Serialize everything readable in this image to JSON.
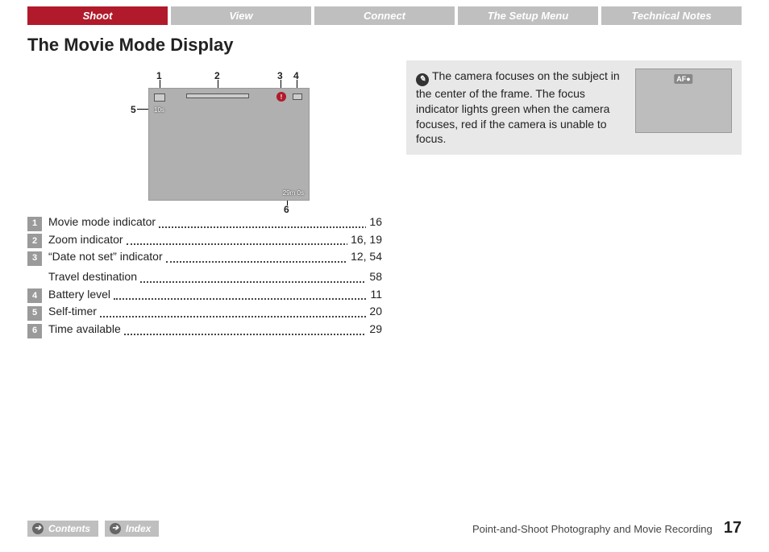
{
  "tabs": [
    "Shoot",
    "View",
    "Connect",
    "The Setup Menu",
    "Technical Notes"
  ],
  "title": "The Movie Mode Display",
  "callouts": {
    "c1": "1",
    "c2": "2",
    "c3": "3",
    "c4": "4",
    "c5": "5",
    "c6": "6"
  },
  "screen": {
    "timer": "10s",
    "avail": "29m 0s"
  },
  "legend": [
    {
      "n": "1",
      "label": "Movie mode indicator",
      "page": "16"
    },
    {
      "n": "2",
      "label": "Zoom indicator",
      "page": "16, 19"
    },
    {
      "n": "3",
      "label": "“Date not set” indicator",
      "page": "12, 54"
    },
    {
      "n": "",
      "label": "Travel destination",
      "page": "58"
    },
    {
      "n": "4",
      "label": "Battery level",
      "page": "11"
    },
    {
      "n": "5",
      "label": "Self-timer",
      "page": "20"
    },
    {
      "n": "6",
      "label": "Time available",
      "page": "29"
    }
  ],
  "note": {
    "text": "The camera focuses on the subject in the center of the frame. The focus indicator lights green when the camera focuses, red if the camera is unable to focus.",
    "af": "AF●"
  },
  "footer": {
    "contents": "Contents",
    "index": "Index",
    "section": "Point-and-Shoot Photography and Movie Recording",
    "page": "17"
  }
}
